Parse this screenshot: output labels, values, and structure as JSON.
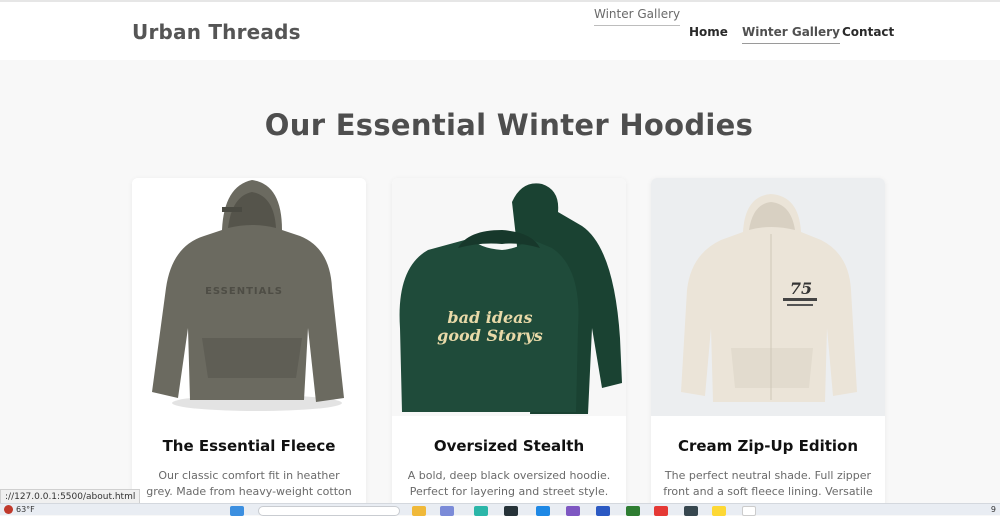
{
  "header": {
    "brand": "Urban Threads",
    "tooltip": "Winter Gallery",
    "nav": {
      "home": "Home",
      "gallery": "Winter Gallery",
      "contact": "Contact"
    }
  },
  "main": {
    "title": "Our Essential Winter Hoodies",
    "cards": [
      {
        "title": "The Essential Fleece",
        "desc": "Our classic comfort fit in heather grey. Made from heavy-weight cotton blend",
        "print": "ESSENTIALS"
      },
      {
        "title": "Oversized Stealth",
        "desc": "A bold, deep black oversized hoodie. Perfect for layering and street style.",
        "print_line1": "bad ideas",
        "print_line2": "good Storys"
      },
      {
        "title": "Cream Zip-Up Edition",
        "desc": "The perfect neutral shade. Full zipper front and a soft fleece lining. Versatile",
        "print": "75"
      }
    ]
  },
  "status_url": "://127.0.0.1:5500/about.html",
  "taskbar": {
    "weather": "63°F",
    "clock": "9"
  },
  "colors": {
    "hoodie_grey": "#6b6a60",
    "hoodie_green": "#1f4b3a",
    "hoodie_cream": "#ebe4d8",
    "print_cream": "#e8d9a8"
  }
}
